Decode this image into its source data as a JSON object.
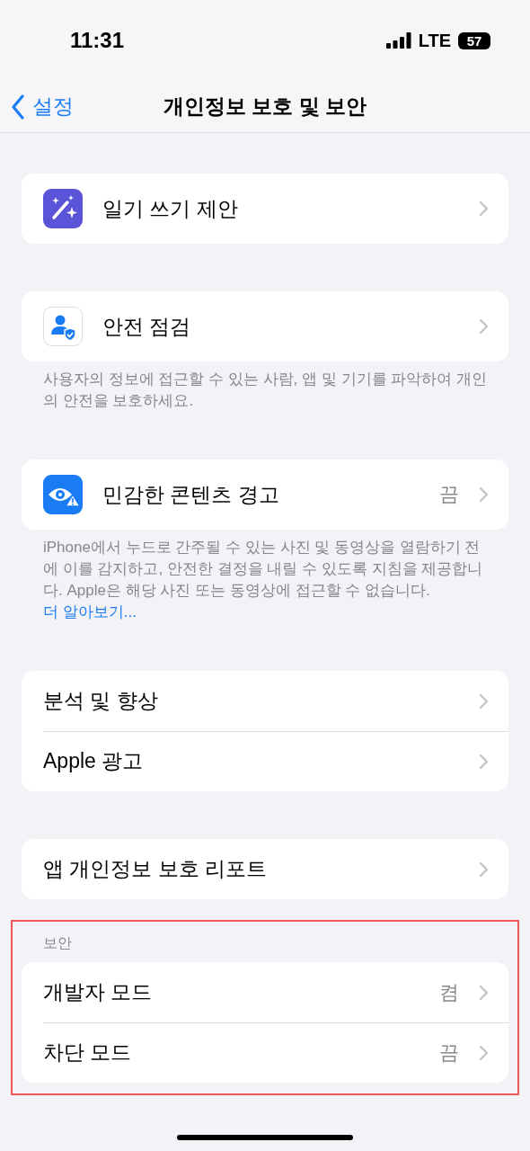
{
  "status_bar": {
    "time": "11:31",
    "network": "LTE",
    "battery": "57"
  },
  "nav": {
    "back_label": "설정",
    "title": "개인정보 보호 및 보안"
  },
  "groups": [
    {
      "highlighted": false,
      "rows": [
        {
          "kind": "journaling",
          "label": "일기 쓰기 제안"
        }
      ]
    },
    {
      "highlighted": false,
      "rows": [
        {
          "kind": "safety-check",
          "label": "안전 점검"
        }
      ],
      "footer": "사용자의 정보에 접근할 수 있는 사람, 앱 및 기기를 파악하여 개인의 안전을 보호하세요."
    },
    {
      "highlighted": false,
      "rows": [
        {
          "kind": "sensitive-content",
          "label": "민감한 콘텐츠 경고",
          "value": "끔"
        }
      ],
      "footer": "iPhone에서 누드로 간주될 수 있는 사진 및 동영상을 열람하기 전에 이를 감지하고, 안전한 결정을 내릴 수 있도록 지침을 제공합니다. Apple은 해당 사진 또는 동영상에 접근할 수 없습니다.",
      "footer_link": "더 알아보기..."
    },
    {
      "highlighted": false,
      "rows": [
        {
          "kind": "plain",
          "label": "분석 및 향상"
        },
        {
          "kind": "plain",
          "label": "Apple 광고"
        }
      ]
    },
    {
      "highlighted": false,
      "rows": [
        {
          "kind": "plain",
          "label": "앱 개인정보 보호 리포트"
        }
      ]
    },
    {
      "highlighted": true,
      "header": "보안",
      "rows": [
        {
          "kind": "plain",
          "label": "개발자 모드",
          "value": "켬"
        },
        {
          "kind": "plain",
          "label": "차단 모드",
          "value": "끔"
        }
      ]
    }
  ]
}
